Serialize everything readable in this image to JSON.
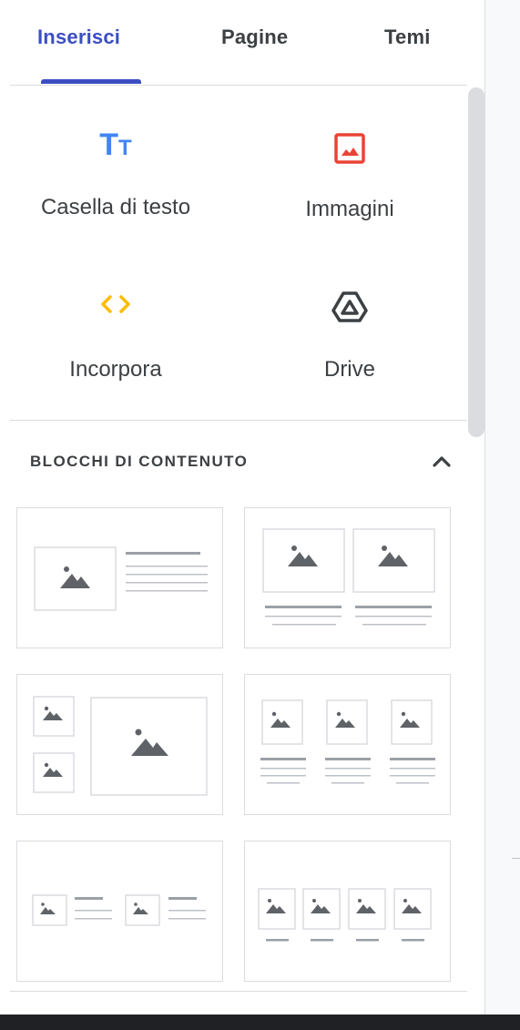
{
  "tabs": [
    {
      "label": "Inserisci",
      "active": true
    },
    {
      "label": "Pagine",
      "active": false
    },
    {
      "label": "Temi",
      "active": false
    }
  ],
  "insert_items": [
    {
      "label": "Casella di testo",
      "icon": "text-box-icon",
      "icon_text": "Tт",
      "color": "#4285f4"
    },
    {
      "label": "Immagini",
      "icon": "image-icon",
      "color": "#ea4335"
    },
    {
      "label": "Incorpora",
      "icon": "embed-code-icon",
      "icon_text": "<>",
      "color": "#fbbc04"
    },
    {
      "label": "Drive",
      "icon": "drive-icon",
      "color": "#3c4043"
    }
  ],
  "content_blocks": {
    "title": "BLOCCHI DI CONTENUTO",
    "collapse_icon": "chevron-up-icon",
    "layouts": [
      "image-left-text-right",
      "two-images-with-text",
      "two-small-one-large-image",
      "three-images-with-text",
      "two-images-inline-text",
      "four-images-with-captions"
    ]
  },
  "colors": {
    "accent": "#3c4ec2",
    "text_icon": "#4285f4",
    "image_icon": "#ea4335",
    "embed_icon": "#fbbc04"
  }
}
